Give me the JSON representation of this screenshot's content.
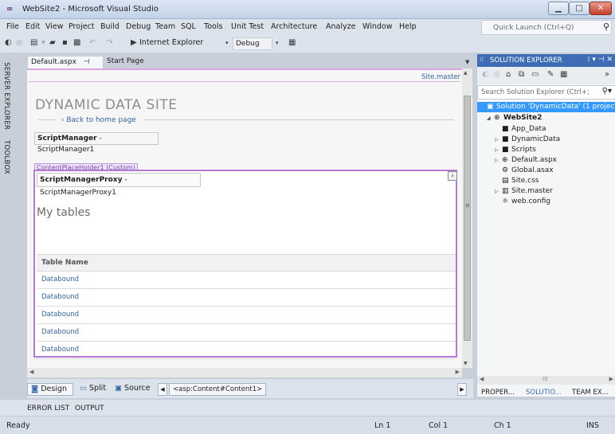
{
  "window": {
    "title": "WebSite2 - Microsoft Visual Studio",
    "logo": "∞",
    "min_label": "▁",
    "max_label": "□",
    "close_label": "✕"
  },
  "menu": [
    "File",
    "Edit",
    "View",
    "Project",
    "Build",
    "Debug",
    "Team",
    "SQL",
    "Tools",
    "Unit Test",
    "Architecture",
    "Analyze",
    "Window",
    "Help"
  ],
  "quick_launch": {
    "placeholder": "Quick Launch (Ctrl+Q)",
    "icon": "search-icon"
  },
  "toolbar": {
    "browser": "Internet Explorer",
    "config": "Debug"
  },
  "side_tabs": {
    "server_explorer": "SERVER EXPLORER",
    "toolbox": "TOOLBOX"
  },
  "doc_tabs": [
    {
      "label": "Default.aspx",
      "pin": "⊣",
      "close": "✕"
    },
    {
      "label": "Start Page"
    }
  ],
  "design": {
    "master_link": "Site.master",
    "site_title": "DYNAMIC DATA SITE",
    "back_link": "Back to home page",
    "script_manager": {
      "type": "ScriptManager",
      "id": " - ScriptManager1"
    },
    "content_placeholder_tag": "ContentPlaceHolder1 (Custom)",
    "script_manager_proxy": {
      "type": "ScriptManagerProxy",
      "id": " - ScriptManagerProxy1"
    },
    "heading": "My tables",
    "table": {
      "header": "Table Name",
      "rows": [
        "Databound",
        "Databound",
        "Databound",
        "Databound",
        "Databound"
      ]
    }
  },
  "view_bar": {
    "design": "Design",
    "split": "Split",
    "source": "Source",
    "tag_path": "<asp:Content#Content1>"
  },
  "bottom_tabs": [
    "ERROR LIST",
    "OUTPUT"
  ],
  "status": {
    "state": "Ready",
    "ln": "Ln 1",
    "col": "Col 1",
    "ch": "Ch 1",
    "mode": "INS"
  },
  "solution_explorer": {
    "title": "SOLUTION EXPLORER",
    "search_placeholder": "Search Solution Explorer (Ctrl+;",
    "tree": [
      {
        "label": "Solution 'DynamicData' (1 project",
        "depth": 0,
        "selected": true,
        "icon": "solution-icon",
        "expander": ""
      },
      {
        "label": "WebSite2",
        "depth": 1,
        "bold": true,
        "icon": "globe-icon",
        "expander": "◢"
      },
      {
        "label": "App_Data",
        "depth": 2,
        "icon": "folder-icon",
        "expander": ""
      },
      {
        "label": "DynamicData",
        "depth": 2,
        "icon": "folder-icon",
        "expander": "▷"
      },
      {
        "label": "Scripts",
        "depth": 2,
        "icon": "folder-icon",
        "expander": "▷"
      },
      {
        "label": "Default.aspx",
        "depth": 2,
        "icon": "globe-icon",
        "expander": "▷"
      },
      {
        "label": "Global.asax",
        "depth": 2,
        "icon": "gear-file-icon",
        "expander": ""
      },
      {
        "label": "Site.css",
        "depth": 2,
        "icon": "css-file-icon",
        "expander": ""
      },
      {
        "label": "Site.master",
        "depth": 2,
        "icon": "master-file-icon",
        "expander": "▷"
      },
      {
        "label": "web.config",
        "depth": 2,
        "icon": "config-file-icon",
        "expander": ""
      }
    ],
    "panel_tabs": [
      "PROPER...",
      "SOLUTIO...",
      "TEAM EX..."
    ]
  }
}
